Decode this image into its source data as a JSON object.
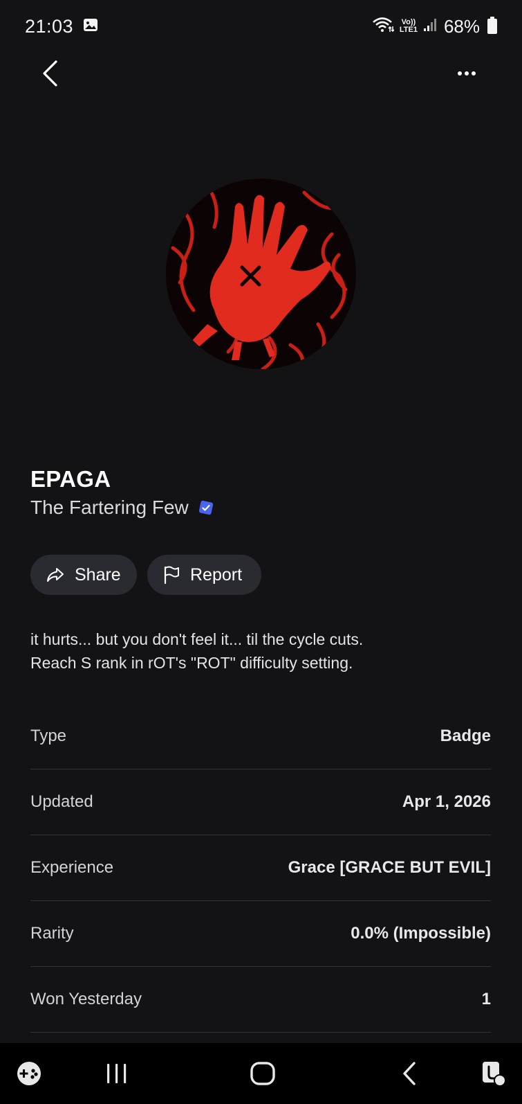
{
  "status_bar": {
    "time": "21:03",
    "network_label_top": "Vo))",
    "network_label_bottom": "LTE1",
    "battery": "68%"
  },
  "nav": {
    "back_icon": "chevron-left-icon",
    "more_icon": "ellipsis-icon"
  },
  "badge": {
    "title": "EPAGA",
    "creator": "The Fartering Few",
    "creator_verified": true,
    "accent_color": "#e12b1f",
    "verified_color": "#4a63f0"
  },
  "actions": {
    "share_label": "Share",
    "report_label": "Report"
  },
  "description": {
    "line1": "it hurts... but you don't feel it... til the cycle cuts.",
    "line2": "Reach S rank in rOT's \"ROT\" difficulty setting."
  },
  "details": [
    {
      "label": "Type",
      "value": "Badge"
    },
    {
      "label": "Updated",
      "value": "Apr 1, 2026"
    },
    {
      "label": "Experience",
      "value": "Grace [GRACE BUT EVIL]"
    },
    {
      "label": "Rarity",
      "value": "0.0% (Impossible)"
    },
    {
      "label": "Won Yesterday",
      "value": "1"
    }
  ],
  "system_nav": {
    "items": [
      "game-launcher-icon",
      "recent-apps-icon",
      "home-icon",
      "back-icon",
      "screen-assist-icon"
    ]
  }
}
